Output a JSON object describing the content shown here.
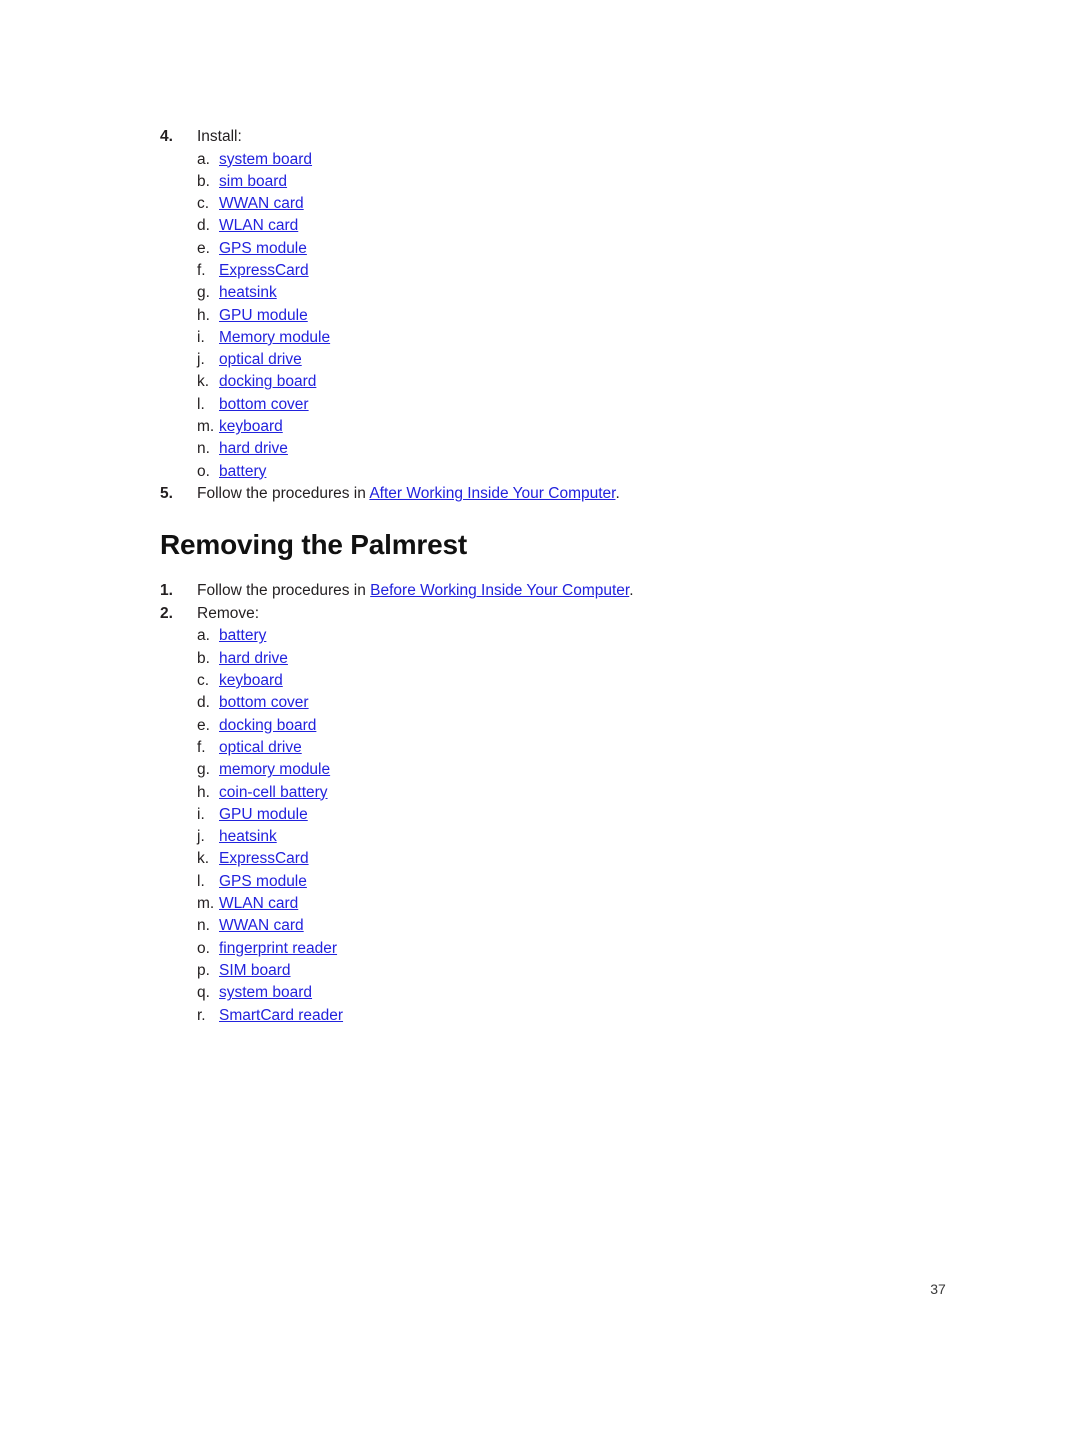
{
  "document": {
    "page_number": "37",
    "link_color": "#2222dd",
    "text_color": "#231f20"
  },
  "blocks": {
    "install_step": {
      "marker": "4.",
      "label": "Install:"
    },
    "install_items": [
      {
        "marker": "a.",
        "label": "system board"
      },
      {
        "marker": "b.",
        "label": "sim board"
      },
      {
        "marker": "c.",
        "label": "WWAN card"
      },
      {
        "marker": "d.",
        "label": "WLAN card"
      },
      {
        "marker": "e.",
        "label": "GPS module"
      },
      {
        "marker": "f.",
        "label": "ExpressCard"
      },
      {
        "marker": "g.",
        "label": "heatsink"
      },
      {
        "marker": "h.",
        "label": "GPU module"
      },
      {
        "marker": "i.",
        "label": "Memory module"
      },
      {
        "marker": "j.",
        "label": "optical drive"
      },
      {
        "marker": "k.",
        "label": "docking board"
      },
      {
        "marker": "l.",
        "label": "bottom cover"
      },
      {
        "marker": "m.",
        "label": "keyboard"
      },
      {
        "marker": "n.",
        "label": "hard drive"
      },
      {
        "marker": "o.",
        "label": "battery"
      }
    ],
    "after_step": {
      "marker": "5.",
      "prefix": "Follow the procedures in ",
      "link": "After Working Inside Your Computer",
      "suffix": "."
    },
    "heading": "Removing the Palmrest",
    "before_step": {
      "marker": "1.",
      "prefix": "Follow the procedures in ",
      "link": "Before Working Inside Your Computer",
      "suffix": "."
    },
    "remove_step": {
      "marker": "2.",
      "label": "Remove:"
    },
    "remove_items": [
      {
        "marker": "a.",
        "label": "battery"
      },
      {
        "marker": "b.",
        "label": "hard drive"
      },
      {
        "marker": "c.",
        "label": "keyboard"
      },
      {
        "marker": "d.",
        "label": "bottom cover"
      },
      {
        "marker": "e.",
        "label": "docking board"
      },
      {
        "marker": "f.",
        "label": "optical drive"
      },
      {
        "marker": "g.",
        "label": "memory module"
      },
      {
        "marker": "h.",
        "label": "coin-cell battery"
      },
      {
        "marker": "i.",
        "label": "GPU module"
      },
      {
        "marker": "j.",
        "label": "heatsink"
      },
      {
        "marker": "k.",
        "label": "ExpressCard"
      },
      {
        "marker": "l.",
        "label": "GPS module"
      },
      {
        "marker": "m.",
        "label": "WLAN card"
      },
      {
        "marker": "n.",
        "label": "WWAN card"
      },
      {
        "marker": "o.",
        "label": "fingerprint reader"
      },
      {
        "marker": "p.",
        "label": "SIM board"
      },
      {
        "marker": "q.",
        "label": "system board"
      },
      {
        "marker": "r.",
        "label": "SmartCard reader"
      }
    ]
  }
}
